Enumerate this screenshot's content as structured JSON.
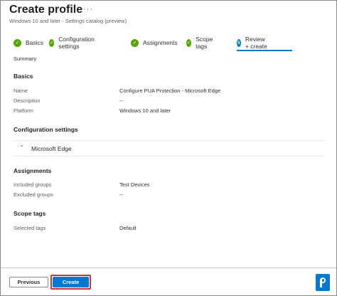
{
  "header": {
    "title": "Create profile",
    "more_icon": "···",
    "subtitle": "Windows 10 and later - Settings catalog (preview)"
  },
  "tabs": [
    {
      "label": "Basics",
      "state": "complete",
      "icon": "check-circle-icon"
    },
    {
      "label": "Configuration settings",
      "state": "complete",
      "icon": "check-circle-icon"
    },
    {
      "label": "Assignments",
      "state": "complete",
      "icon": "check-circle-icon"
    },
    {
      "label": "Scope tags",
      "state": "complete",
      "icon": "check-circle-icon"
    },
    {
      "label": "Review + create",
      "state": "active",
      "step": "5"
    }
  ],
  "summary_label": "Summary",
  "basics": {
    "heading": "Basics",
    "rows": [
      {
        "label": "Name",
        "value": "Configure PUA Protection - Microsoft Edge"
      },
      {
        "label": "Description",
        "value": "--"
      },
      {
        "label": "Platform",
        "value": "Windows 10 and later"
      }
    ]
  },
  "configuration": {
    "heading": "Configuration settings",
    "accordion_label": "Microsoft Edge"
  },
  "assignments": {
    "heading": "Assignments",
    "rows": [
      {
        "label": "Included groups",
        "value": "Test Devices"
      },
      {
        "label": "Excluded groups",
        "value": "--"
      }
    ]
  },
  "scope_tags": {
    "heading": "Scope tags",
    "rows": [
      {
        "label": "Selected tags",
        "value": "Default"
      }
    ]
  },
  "footer": {
    "previous_label": "Previous",
    "create_label": "Create"
  },
  "colors": {
    "accent": "#0078d4",
    "complete": "#57a300",
    "highlight": "#d13438"
  }
}
